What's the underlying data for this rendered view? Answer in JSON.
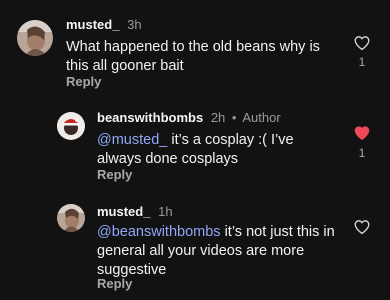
{
  "comments": [
    {
      "username": "musted_",
      "time": "3h",
      "text": "What happened to the old beans why is this all gooner bait",
      "reply_label": "Reply",
      "likes": "1",
      "liked": false
    },
    {
      "username": "beanswithbombs",
      "time": "2h",
      "dot": "•",
      "author_label": "Author",
      "mention": "@musted_",
      "text": " it’s a cosplay :( I’ve always done cosplays",
      "reply_label": "Reply",
      "likes": "1",
      "liked": true
    },
    {
      "username": "musted_",
      "time": "1h",
      "mention": "@beanswithbombs",
      "text": " it’s not just this in general all your videos are more suggestive",
      "reply_label": "Reply",
      "liked": false
    }
  ],
  "colors": {
    "background": "#121212",
    "mention": "#8fa8f7",
    "liked_heart": "#ed4956",
    "secondary_text": "#9a9a9a"
  },
  "icons": {
    "like": "heart-outline-icon",
    "liked": "heart-filled-icon"
  }
}
